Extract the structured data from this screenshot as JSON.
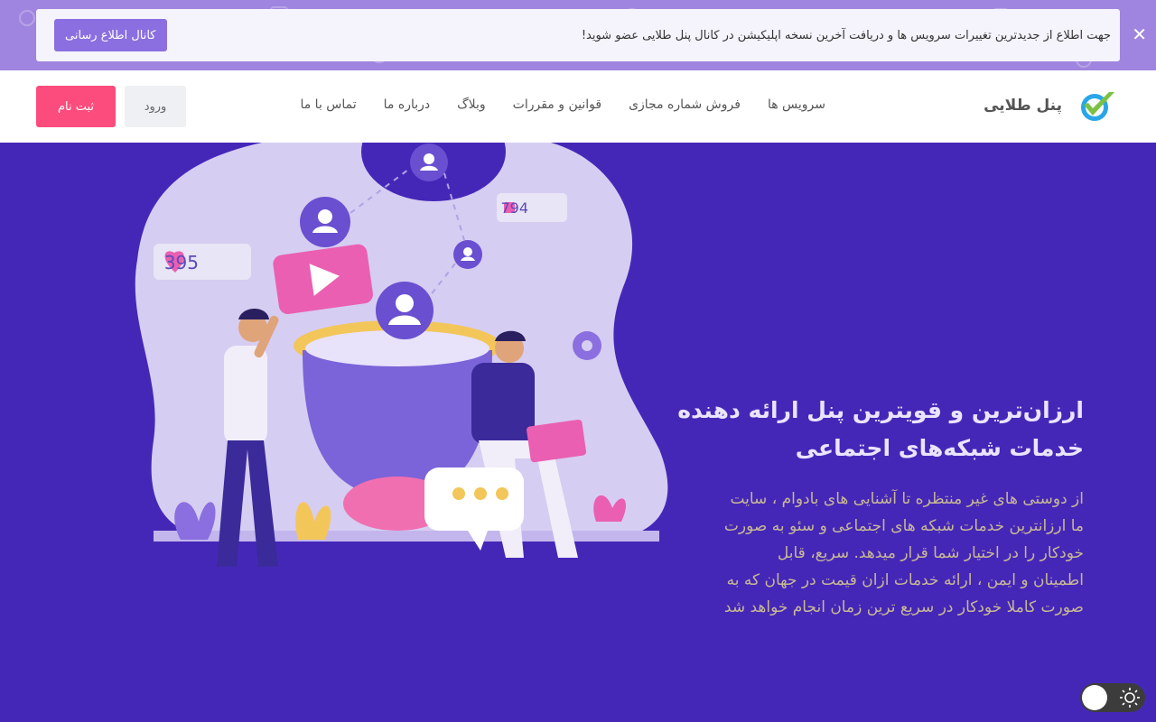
{
  "announcement": {
    "text": "جهت اطلاع از جدیدترین تغییرات سرویس ها و دریافت آخرین نسخه اپلیکیشن در کانال پنل طلایی عضو شوید!",
    "button_label": "کانال اطلاع رسانی",
    "close_symbol": "✕"
  },
  "header": {
    "brand_name": "پنل طلایی",
    "logo_icon": "checkmark-logo-icon",
    "nav": [
      {
        "label": "سرویس ها"
      },
      {
        "label": "فروش شماره مجازی"
      },
      {
        "label": "قوانین و مقررات"
      },
      {
        "label": "وبلاگ"
      },
      {
        "label": "درباره ما"
      },
      {
        "label": "تماس با ما"
      }
    ],
    "login_label": "ورود",
    "signup_label": "ثبت نام"
  },
  "hero": {
    "title": "ارزان‌ترین و قویترین پنل ارائه دهنده خدمات شبکه‌های اجتماعی",
    "description": "از دوستی های غیر منتظره تا آشنایی های بادوام ، سایت ما ارزانترین خدمات شبکه های اجتماعی و سئو به صورت خودکار را در اختیار شما قرار میدهد. سریع، قابل اطمینان و ایمن ، ارائه خدمات ازان قیمت در جهان که به صورت کاملا خودکار در سریع ترین زمان انجام خواهد شد",
    "badges": {
      "likes": "395",
      "thumbs": "794"
    }
  },
  "theme_toggle": {
    "icon": "sun-icon"
  },
  "colors": {
    "hero_bg": "#4527b8",
    "accent_purple": "#8b6fe0",
    "signup_pink": "#fb4c7d",
    "announce_bg": "#9f85df"
  }
}
